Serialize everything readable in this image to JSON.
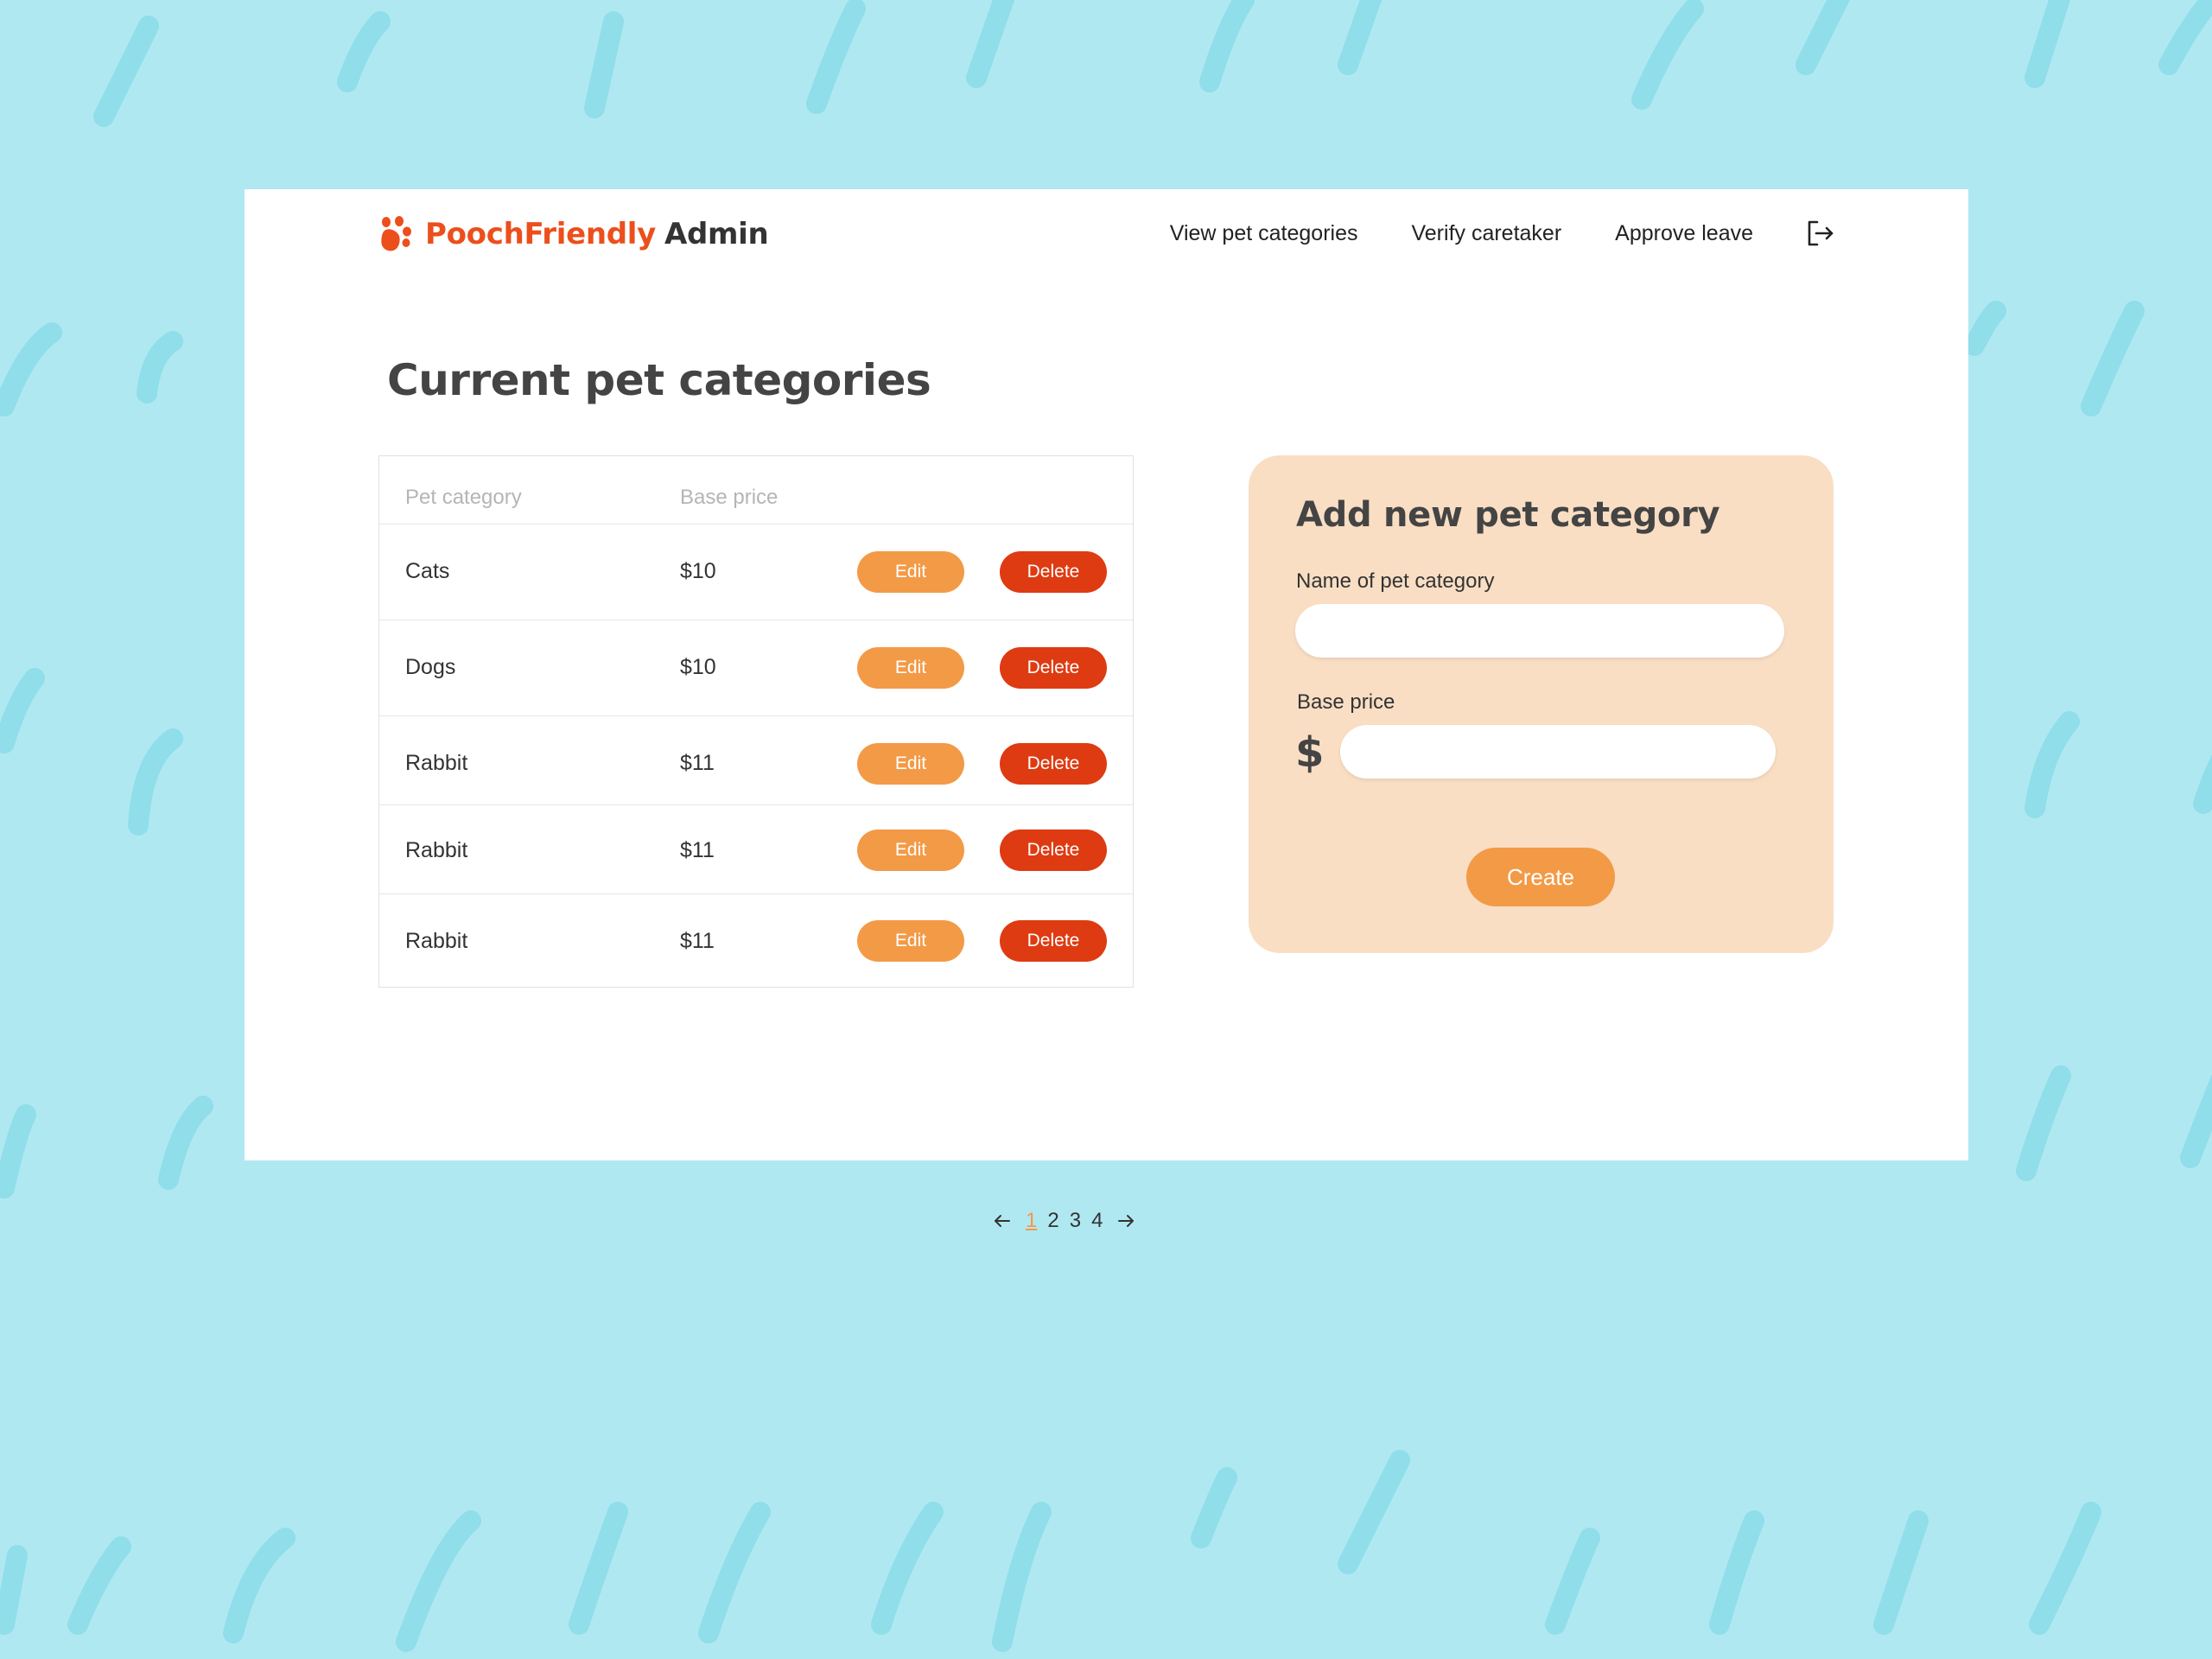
{
  "brand": {
    "name": "PoochFriendly",
    "suffix": "Admin"
  },
  "nav": {
    "items": [
      "View pet categories",
      "Verify caretaker",
      "Approve leave"
    ],
    "logout_icon": "logout-icon"
  },
  "main": {
    "title": "Current pet categories"
  },
  "table": {
    "headers": [
      "Pet category",
      "Base price"
    ],
    "rows": [
      {
        "category": "Cats",
        "price": "$10"
      },
      {
        "category": "Dogs",
        "price": "$10"
      },
      {
        "category": "Rabbit",
        "price": "$11"
      },
      {
        "category": "Rabbit",
        "price": "$11"
      },
      {
        "category": "Rabbit",
        "price": "$11"
      }
    ],
    "edit_label": "Edit",
    "delete_label": "Delete"
  },
  "pagination": {
    "pages": [
      "1",
      "2",
      "3",
      "4"
    ],
    "current": "1"
  },
  "form": {
    "title": "Add new pet category",
    "name_label": "Name of pet category",
    "name_value": "",
    "price_label": "Base price",
    "price_value": "",
    "currency_symbol": "$",
    "submit_label": "Create"
  },
  "colors": {
    "background": "#b0e8f2",
    "brand_orange": "#ec4f1c",
    "edit_button": "#f39a47",
    "delete_button": "#de3b12",
    "card_background": "#f9dec4"
  }
}
